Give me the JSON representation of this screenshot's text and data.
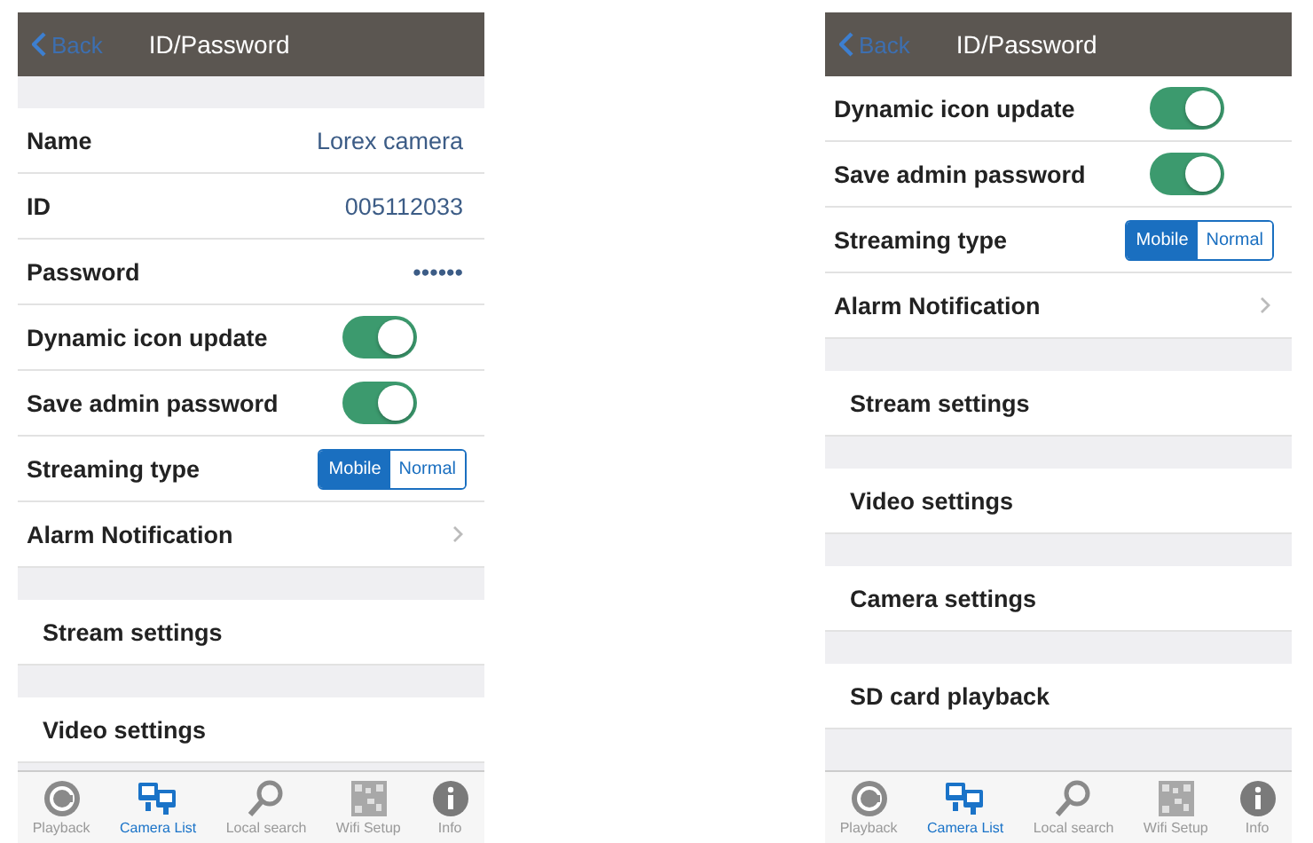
{
  "screens": [
    {
      "header": {
        "back": "Back",
        "title": "ID/Password"
      },
      "rows": [
        {
          "kind": "gap"
        },
        {
          "kind": "value",
          "label": "Name",
          "value": "Lorex camera"
        },
        {
          "kind": "value",
          "label": "ID",
          "value": "005112033"
        },
        {
          "kind": "value",
          "label": "Password",
          "value": "••••••"
        },
        {
          "kind": "toggle",
          "label": "Dynamic icon update",
          "on": true
        },
        {
          "kind": "toggle",
          "label": "Save admin password",
          "on": true
        },
        {
          "kind": "segmented",
          "label": "Streaming type",
          "options": [
            {
              "label": "Mobile",
              "selected": true
            },
            {
              "label": "Normal",
              "selected": false
            }
          ]
        },
        {
          "kind": "link",
          "label": "Alarm Notification"
        },
        {
          "kind": "gap"
        },
        {
          "kind": "plain",
          "label": "Stream settings"
        },
        {
          "kind": "gap"
        },
        {
          "kind": "plain",
          "label": "Video settings"
        }
      ],
      "tabbar": [
        {
          "kind": "playback",
          "label": "Playback",
          "selected": false
        },
        {
          "kind": "cameras",
          "label": "Camera List",
          "selected": true
        },
        {
          "kind": "search",
          "label": "Local search",
          "selected": false
        },
        {
          "kind": "qr",
          "label": "Wifi Setup",
          "selected": false
        },
        {
          "kind": "info",
          "label": "Info",
          "selected": false
        }
      ]
    },
    {
      "header": {
        "back": "Back",
        "title": "ID/Password"
      },
      "rows": [
        {
          "kind": "toggle",
          "label": "Dynamic icon update",
          "on": true
        },
        {
          "kind": "toggle",
          "label": "Save admin password",
          "on": true
        },
        {
          "kind": "segmented",
          "label": "Streaming type",
          "options": [
            {
              "label": "Mobile",
              "selected": true
            },
            {
              "label": "Normal",
              "selected": false
            }
          ]
        },
        {
          "kind": "link",
          "label": "Alarm Notification"
        },
        {
          "kind": "gap"
        },
        {
          "kind": "plain",
          "label": "Stream settings"
        },
        {
          "kind": "gap"
        },
        {
          "kind": "plain",
          "label": "Video settings"
        },
        {
          "kind": "gap"
        },
        {
          "kind": "plain",
          "label": "Camera settings"
        },
        {
          "kind": "gap"
        },
        {
          "kind": "plain",
          "label": "SD card playback"
        },
        {
          "kind": "gap"
        }
      ],
      "tabbar": [
        {
          "kind": "playback",
          "label": "Playback",
          "selected": false
        },
        {
          "kind": "cameras",
          "label": "Camera List",
          "selected": true
        },
        {
          "kind": "search",
          "label": "Local search",
          "selected": false
        },
        {
          "kind": "qr",
          "label": "Wifi Setup",
          "selected": false
        },
        {
          "kind": "info",
          "label": "Info",
          "selected": false
        }
      ]
    }
  ]
}
